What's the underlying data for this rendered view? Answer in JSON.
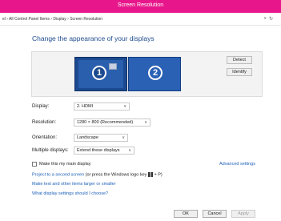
{
  "window": {
    "title": "Screen Resolution"
  },
  "address": {
    "crumbs": "el  ›  All Control Panel Items  ›  Display  ›  Screen Resolution",
    "dropdown_glyph": "∨",
    "refresh_glyph": "↻"
  },
  "heading": "Change the appearance of your displays",
  "monitors": [
    {
      "number": "1"
    },
    {
      "number": "2"
    }
  ],
  "buttons": {
    "detect": "Detect",
    "identify": "Identify"
  },
  "settings": [
    {
      "label": "Display:",
      "value": "2. HDMI"
    },
    {
      "label": "Resolution:",
      "value": "1280 × 800 (Recommended)"
    },
    {
      "label": "Orientation:",
      "value": "Landscape"
    },
    {
      "label": "Multiple displays:",
      "value": "Extend these displays"
    }
  ],
  "main_display": {
    "label": "Make this my main display",
    "checked": false
  },
  "advanced_link": "Advanced settings",
  "project_link": "Project to a second screen",
  "project_note_before": " (or press the Windows logo key ",
  "project_note_after": " + P)",
  "links": [
    "Make text and other items larger or smaller",
    "What display settings should I choose?"
  ],
  "footer": {
    "ok": "OK",
    "cancel": "Cancel",
    "apply": "Apply"
  },
  "colors": {
    "titlebar": "#e7178b",
    "link": "#1c5fb8",
    "monitor1": "#1b4a90",
    "monitor2": "#2a61b5"
  }
}
